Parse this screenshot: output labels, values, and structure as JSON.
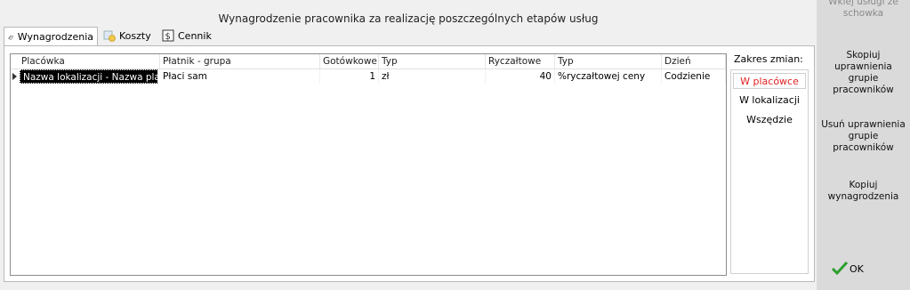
{
  "window": {
    "title": "Wynagrodzenie pracownika za realizację poszczególnych etapów usług"
  },
  "tabs": [
    {
      "label": "Wynagrodzenia",
      "icon": "money-icon",
      "active": true
    },
    {
      "label": "Koszty",
      "icon": "coins-icon",
      "active": false
    },
    {
      "label": "Cennik",
      "icon": "price-list-icon",
      "active": false
    }
  ],
  "grid": {
    "columns": [
      "Placówka",
      "Płatnik - grupa",
      "Gotówkowe",
      "Typ",
      "Ryczałtowe",
      "Typ",
      "Dzień"
    ],
    "rows": [
      [
        "Nazwa lokalizacji - Nazwa placó",
        "Płaci sam",
        "1",
        "zł",
        "40",
        "%ryczałtowej ceny",
        "Codzienie"
      ]
    ]
  },
  "scope": {
    "label": "Zakres zmian:",
    "options": [
      "W placówce",
      "W lokalizacji",
      "Wszędzie"
    ],
    "selected": "W placówce"
  },
  "sidebar": {
    "buttons": [
      {
        "label": "Wklej usługi ze schowka",
        "enabled": false
      },
      {
        "label": "Skopiuj uprawnienia grupie pracowników",
        "enabled": true
      },
      {
        "label": "Usuń uprawnienia grupie pracowników",
        "enabled": true
      },
      {
        "label": "Kopiuj wynagrodzenia",
        "enabled": true
      }
    ],
    "ok_label": "OK"
  },
  "colors": {
    "accent_red": "#e02020",
    "ok_green": "#2e9e2e",
    "sidebar_bg": "#dadada"
  }
}
